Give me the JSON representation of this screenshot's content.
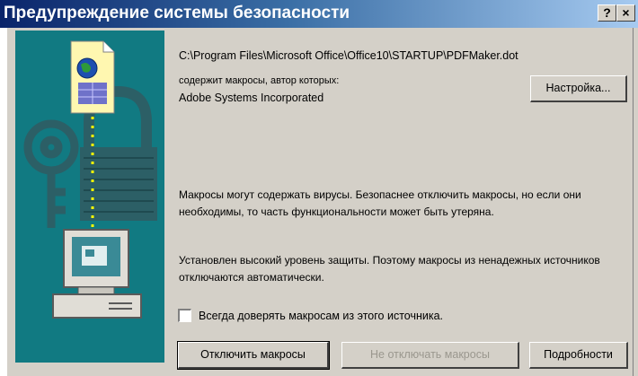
{
  "window": {
    "title": "Предупреждение системы безопасности",
    "help_label": "?",
    "close_label": "×"
  },
  "macro": {
    "path": "C:\\Program Files\\Microsoft Office\\Office10\\STARTUP\\PDFMaker.dot",
    "contains_label": "содержит макросы, автор которых:",
    "author": "Adobe Systems Incorporated"
  },
  "buttons": {
    "settings": "Настройка...",
    "disable": "Отключить макросы",
    "enable": "Не отключать макросы",
    "details": "Подробности"
  },
  "messages": {
    "warning": "Макросы могут содержать вирусы. Безопаснее отключить макросы, но если они необходимы, то часть функциональности может быть утеряна.",
    "security_level": "Установлен высокий уровень защиты. Поэтому макросы из ненадежных источников отключаются автоматически."
  },
  "trust_checkbox": {
    "label": "Всегда доверять макросам из этого источника.",
    "checked": false
  },
  "colors": {
    "title_gradient_start": "#0a246a",
    "title_gradient_end": "#a6caf0",
    "illustration_bg": "#117a82",
    "dialog_bg": "#d4d0c8"
  },
  "icons": {
    "illustration": "security-illustration",
    "document": "document-icon",
    "globe": "globe-icon",
    "keys": "keys-icon",
    "padlock": "padlock-icon",
    "computer": "computer-icon"
  }
}
